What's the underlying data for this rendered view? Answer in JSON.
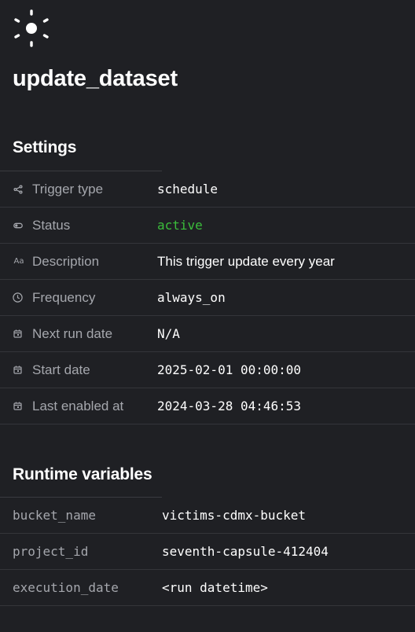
{
  "colors": {
    "background": "#1f2024",
    "status_active": "#3bbd3b",
    "muted_text": "#a5a7ad"
  },
  "header": {
    "icon": "sun-icon",
    "title": "update_dataset"
  },
  "settings": {
    "heading": "Settings",
    "rows": [
      {
        "icon": "share-icon",
        "label": "Trigger type",
        "value": "schedule"
      },
      {
        "icon": "toggle-icon",
        "label": "Status",
        "value": "active"
      },
      {
        "icon": "text-aa-icon",
        "label": "Description",
        "value": "This trigger update every year"
      },
      {
        "icon": "clock-icon",
        "label": "Frequency",
        "value": "always_on"
      },
      {
        "icon": "calendar-icon",
        "label": "Next run date",
        "value": "N/A"
      },
      {
        "icon": "calendar-icon",
        "label": "Start date",
        "value": "2025-02-01 00:00:00"
      },
      {
        "icon": "calendar-icon",
        "label": "Last enabled at",
        "value": "2024-03-28 04:46:53"
      }
    ]
  },
  "runtime_variables": {
    "heading": "Runtime variables",
    "rows": [
      {
        "name": "bucket_name",
        "value": "victims-cdmx-bucket"
      },
      {
        "name": "project_id",
        "value": "seventh-capsule-412404"
      },
      {
        "name": "execution_date",
        "value": "<run datetime>"
      }
    ]
  }
}
